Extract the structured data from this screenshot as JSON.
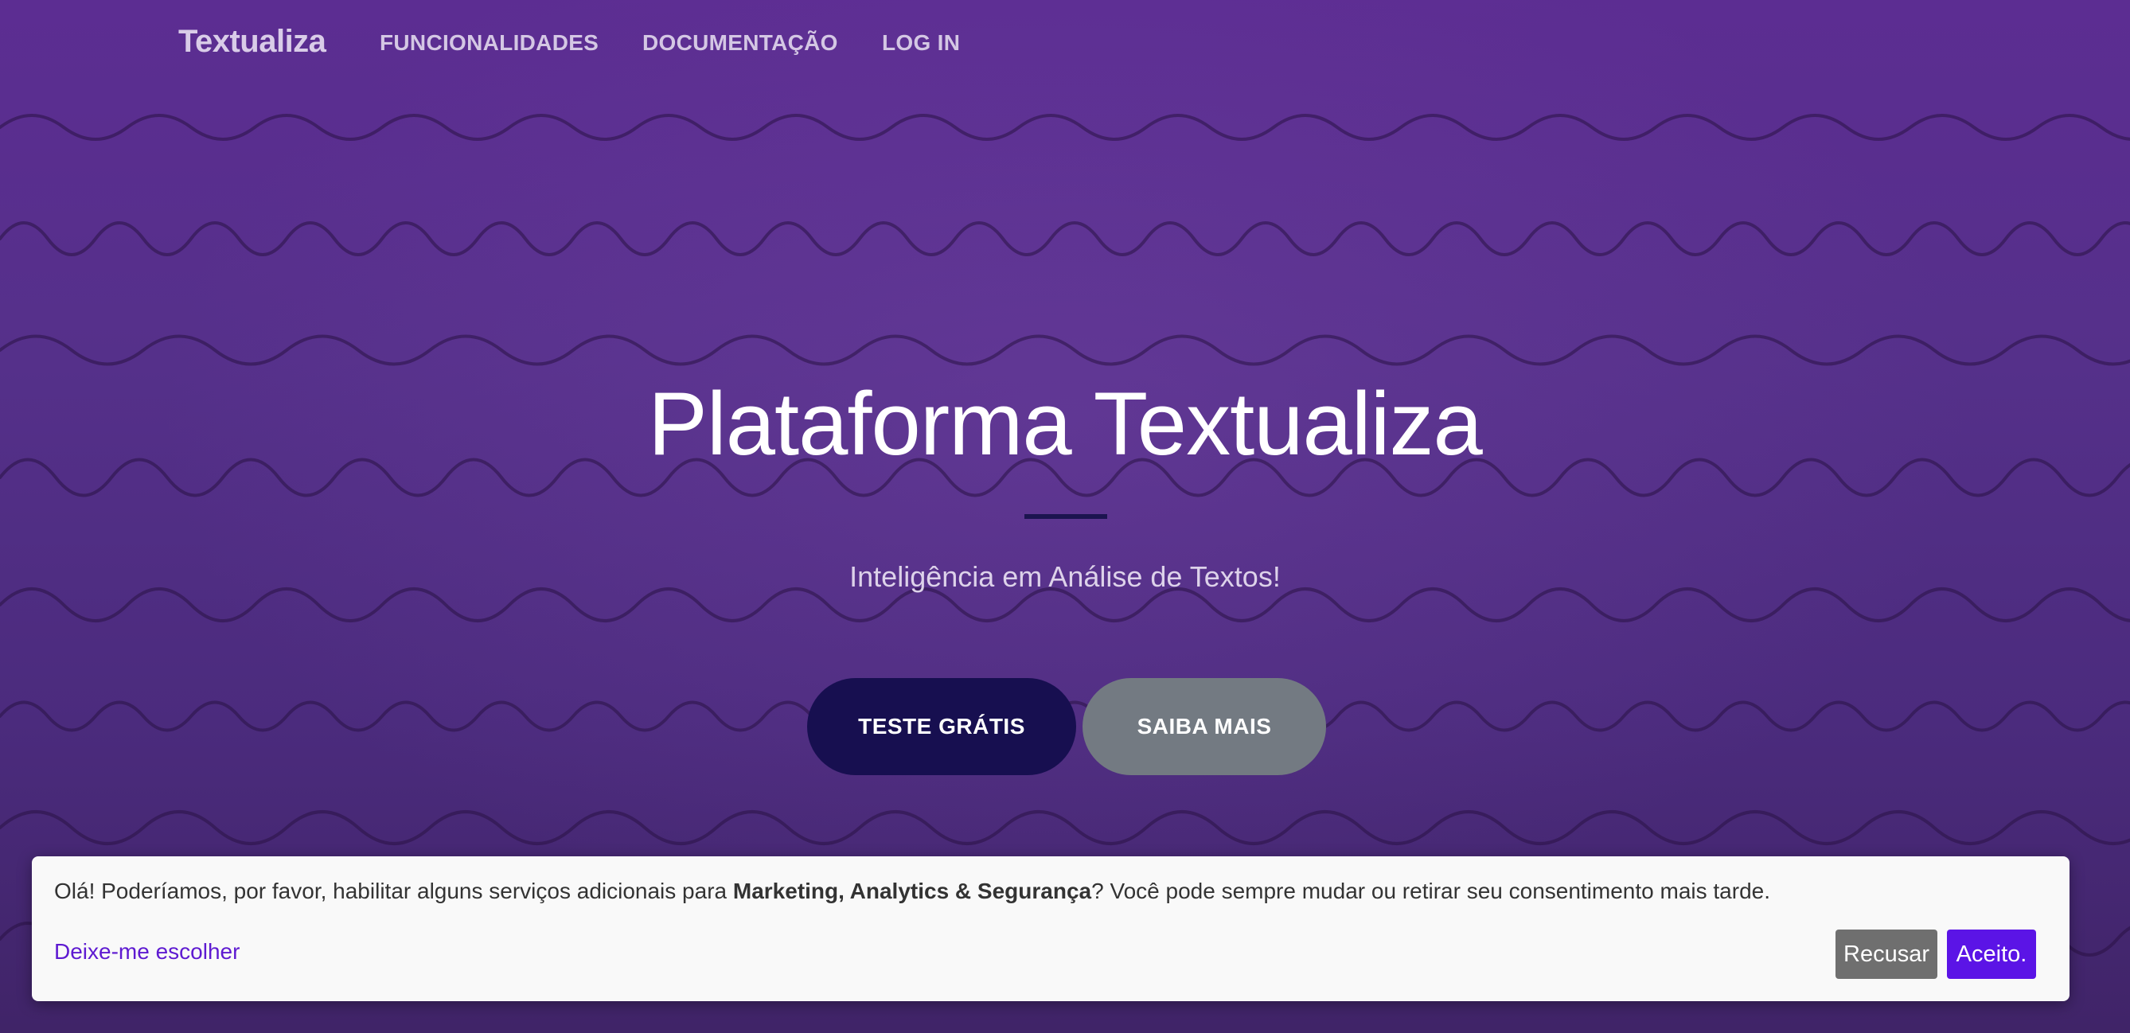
{
  "nav": {
    "brand": "Textualiza",
    "links": [
      "FUNCIONALIDADES",
      "DOCUMENTAÇÃO",
      "LOG IN"
    ]
  },
  "hero": {
    "title": "Plataforma Textualiza",
    "subtitle": "Inteligência em Análise de Textos!",
    "primary_button": "TESTE GRÁTIS",
    "secondary_button": "SAIBA MAIS"
  },
  "cookie_banner": {
    "text_before": "Olá! Poderíamos, por favor, habilitar alguns serviços adicionais para ",
    "text_bold": "Marketing, Analytics & Segurança",
    "text_after": "? Você pode sempre mudar ou retirar seu consentimento mais tarde.",
    "choose_link": "Deixe-me escolher",
    "decline_button": "Recusar",
    "accept_button": "Aceito."
  },
  "colors": {
    "hero_background": "#55308a",
    "primary_button": "#170f50",
    "secondary_button": "#737a82",
    "accept_button": "#5b14e6",
    "decline_button": "#6f6f6f",
    "link": "#5e1ad1"
  }
}
